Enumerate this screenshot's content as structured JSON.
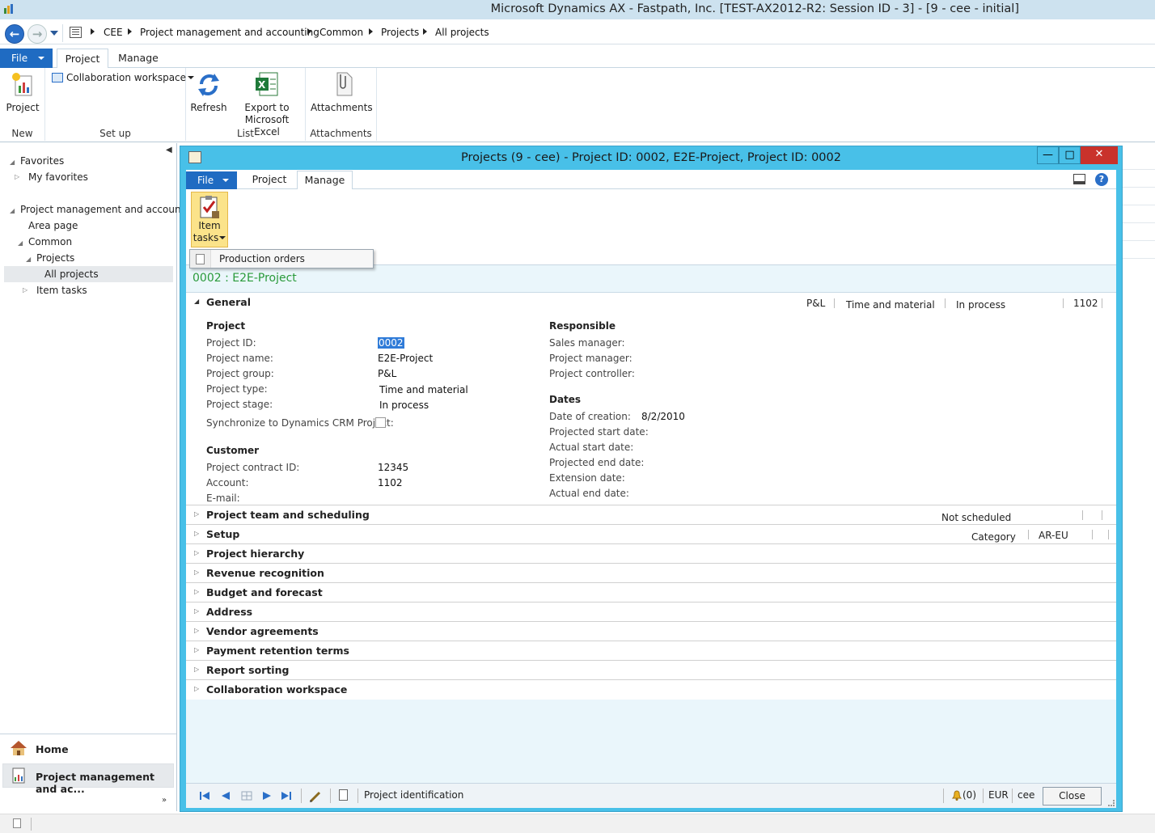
{
  "app": {
    "window_title": "Microsoft Dynamics AX - Fastpath, Inc. [TEST-AX2012-R2: Session ID - 3] -  [9 - cee - initial]"
  },
  "breadcrumb": [
    "CEE",
    "Project management and accounting",
    "Common",
    "Projects",
    "All projects"
  ],
  "main_tabs": {
    "file": "File",
    "project": "Project",
    "manage": "Manage"
  },
  "ribbon": {
    "new_group": {
      "label": "New",
      "project_button": "Project"
    },
    "setup_group": {
      "label": "Set up",
      "collab_button": "Collaboration workspace"
    },
    "list_group": {
      "label": "List",
      "refresh": "Refresh",
      "export_line1": "Export to",
      "export_line2": "Microsoft Excel"
    },
    "attachments_group": {
      "label": "Attachments",
      "attachments": "Attachments"
    }
  },
  "navpane": {
    "favorites": "Favorites",
    "my_favorites": "My favorites",
    "module": "Project management and accoun...",
    "area_page": "Area page",
    "common": "Common",
    "projects": "Projects",
    "all_projects": "All projects",
    "item_tasks": "Item tasks",
    "home": "Home",
    "module_button": "Project management and ac..."
  },
  "form": {
    "title": "Projects (9 - cee) - Project ID: 0002, E2E-Project, Project ID: 0002",
    "tabs": {
      "file": "File",
      "project": "Project",
      "manage": "Manage"
    },
    "item_tasks_line1": "Item",
    "item_tasks_line2": "tasks",
    "dropdown_item": "Production orders",
    "record_title": "0002 : E2E-Project",
    "general": {
      "header": "General",
      "summary": {
        "group": "P&L",
        "type": "Time and material",
        "stage": "In process",
        "account": "1102"
      },
      "project_section": "Project",
      "fields": {
        "project_id_label": "Project ID:",
        "project_id": "0002",
        "project_name_label": "Project name:",
        "project_name": "E2E-Project",
        "project_group_label": "Project group:",
        "project_group": "P&L",
        "project_type_label": "Project type:",
        "project_type": "Time and material",
        "project_stage_label": "Project stage:",
        "project_stage": "In process",
        "sync_label": "Synchronize to Dynamics CRM Project:"
      },
      "customer_section": "Customer",
      "customer": {
        "contract_label": "Project contract ID:",
        "contract": "12345",
        "account_label": "Account:",
        "account": "1102",
        "email_label": "E-mail:"
      },
      "responsible_section": "Responsible",
      "responsible": {
        "sales_manager": "Sales manager:",
        "project_manager": "Project manager:",
        "project_controller": "Project controller:"
      },
      "dates_section": "Dates",
      "dates": {
        "creation_label": "Date of creation:",
        "creation": "8/2/2010",
        "proj_start": "Projected start date:",
        "actual_start": "Actual start date:",
        "proj_end": "Projected end date:",
        "extension": "Extension date:",
        "actual_end": "Actual end date:"
      }
    },
    "fasttabs": [
      {
        "title": "Project team and scheduling"
      },
      {
        "title": "Setup"
      },
      {
        "title": "Project hierarchy"
      },
      {
        "title": "Revenue recognition"
      },
      {
        "title": "Budget and forecast"
      },
      {
        "title": "Address"
      },
      {
        "title": "Vendor agreements"
      },
      {
        "title": "Payment retention terms"
      },
      {
        "title": "Report sorting"
      },
      {
        "title": "Collaboration workspace"
      }
    ],
    "team_summary": "Not scheduled",
    "setup_summary": {
      "label": "Category",
      "value": "AR-EU"
    },
    "status": {
      "field_desc": "Project identification",
      "notifications": "(0)",
      "currency": "EUR",
      "company": "cee",
      "close": "Close"
    }
  },
  "colors": {
    "form_border": "#48c0e8",
    "file_tab": "#1f6bc2",
    "record_title": "#2a9a3a",
    "item_tasks_highlight": "#fbe38a"
  }
}
